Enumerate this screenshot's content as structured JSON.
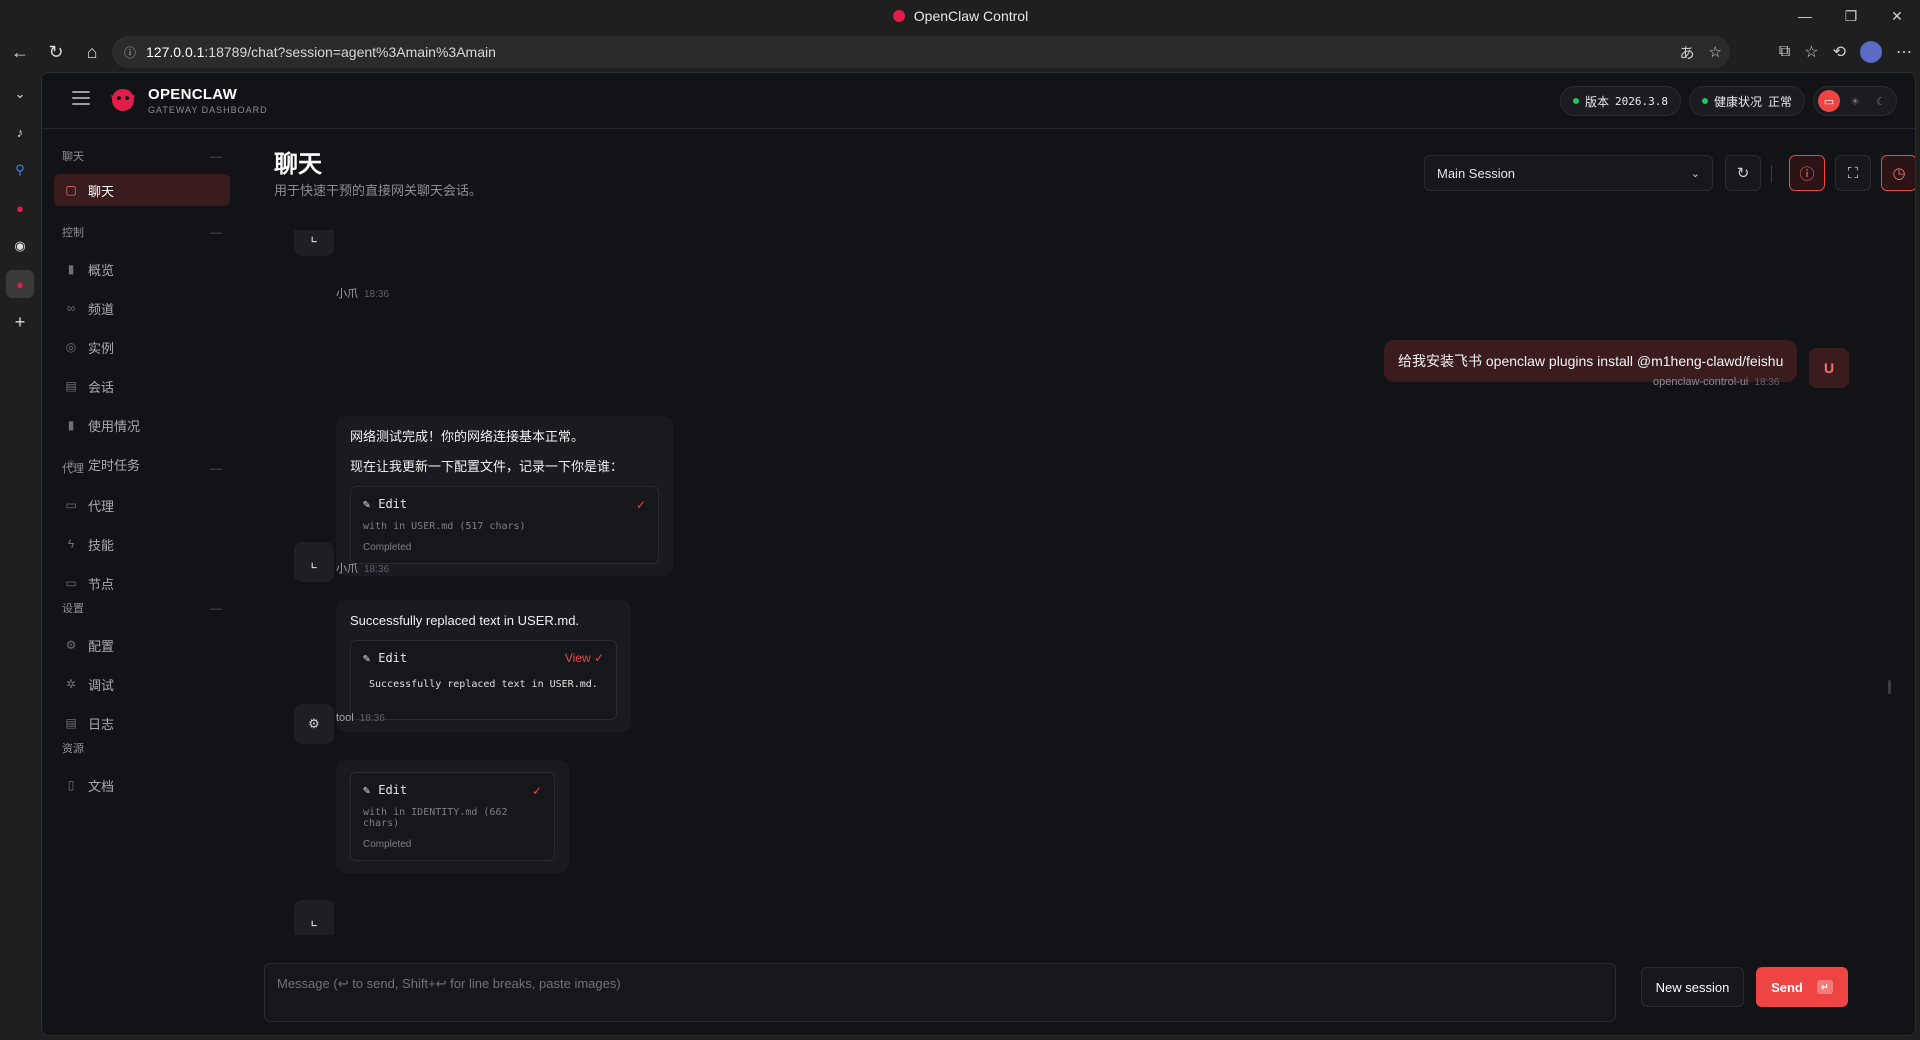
{
  "browser": {
    "tab_title": "OpenClaw Control",
    "url_host": "127.0.0.1",
    "url_rest": ":18789/chat?session=agent%3Amain%3Amain"
  },
  "app": {
    "brand_name": "OPENCLAW",
    "brand_sub": "GATEWAY DASHBOARD",
    "version_label": "版本",
    "version_value": "2026.3.8",
    "health_label": "健康状况",
    "health_value": "正常"
  },
  "sidenav": {
    "groups": [
      {
        "title": "聊天",
        "items": [
          {
            "label": "聊天",
            "icon": "chat-icon",
            "active": true
          }
        ]
      },
      {
        "title": "控制",
        "items": [
          {
            "label": "概览",
            "icon": "bar-chart-icon"
          },
          {
            "label": "频道",
            "icon": "link-icon"
          },
          {
            "label": "实例",
            "icon": "broadcast-icon"
          },
          {
            "label": "会话",
            "icon": "document-icon"
          },
          {
            "label": "使用情况",
            "icon": "bar-chart-icon"
          },
          {
            "label": "定时任务",
            "icon": "loader-icon"
          }
        ]
      },
      {
        "title": "代理",
        "items": [
          {
            "label": "代理",
            "icon": "folder-icon"
          },
          {
            "label": "技能",
            "icon": "zap-icon"
          },
          {
            "label": "节点",
            "icon": "monitor-icon"
          }
        ]
      },
      {
        "title": "设置",
        "items": [
          {
            "label": "配置",
            "icon": "gear-icon"
          },
          {
            "label": "调试",
            "icon": "bug-icon"
          },
          {
            "label": "日志",
            "icon": "scroll-icon"
          }
        ]
      },
      {
        "title": "资源",
        "items": [
          {
            "label": "文档",
            "icon": "book-icon"
          }
        ]
      }
    ]
  },
  "main": {
    "title": "聊天",
    "subtitle": "用于快速干预的直接网关聊天会话。",
    "session_select": "Main Session"
  },
  "chat": {
    "msg0_author": "小爪",
    "msg0_time": "18:36",
    "user_text": "给我安装飞书 openclaw plugins install @m1heng-clawd/feishu",
    "user_author": "openclaw-control-ui",
    "user_time": "18:36",
    "user_avatar": "U",
    "msg1_line1": "网络测试完成！你的网络连接基本正常。",
    "msg1_line2": "现在让我更新一下配置文件，记录一下你是谁：",
    "msg1_tool_name": "Edit",
    "msg1_tool_detail": "with in USER.md (517 chars)",
    "msg1_tool_status": "Completed",
    "msg1_author": "小爪",
    "msg1_time": "18:36",
    "msg2_text": "Successfully replaced text in USER.md.",
    "msg2_tool_name": "Edit",
    "msg2_view": "View ✓",
    "msg2_tool_output": "Successfully replaced text in USER.md.",
    "msg2_author": "tool",
    "msg2_time": "18:36",
    "msg3_tool_name": "Edit",
    "msg3_tool_detail": "with in IDENTITY.md (662 chars)",
    "msg3_tool_status": "Completed"
  },
  "composer": {
    "placeholder": "Message (↩ to send, Shift+↩ for line breaks, paste images)",
    "new_session": "New session",
    "send": "Send"
  },
  "colors": {
    "accent": "#ef4444",
    "bg": "#121317",
    "ok": "#22c55e"
  }
}
